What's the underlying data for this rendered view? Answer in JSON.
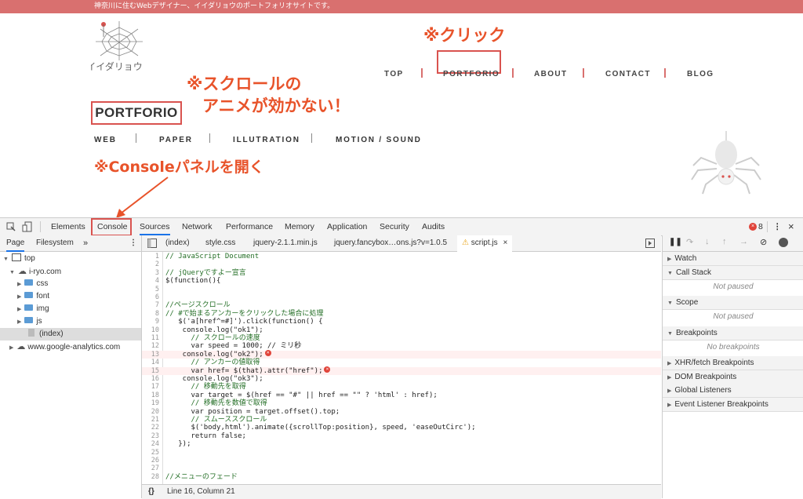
{
  "site": {
    "tagline": "神奈川に住むWebデザイナー、イイダリョウのポートフォリオサイトです。",
    "logo_text": "イイダリョウ",
    "nav": [
      "TOP",
      "PORTFORIO",
      "ABOUT",
      "CONTACT",
      "BLOG"
    ],
    "page_title": "PORTFORIO",
    "subnav": [
      "WEB",
      "PAPER",
      "ILLUTRATION",
      "MOTION / SOUND"
    ]
  },
  "annotations": {
    "click": "※クリック",
    "scroll_line1": "※スクロールの",
    "scroll_line2": "アニメが効かない！",
    "console": "※Consoleパネルを開く"
  },
  "devtools": {
    "tabs": [
      "Elements",
      "Console",
      "Sources",
      "Network",
      "Performance",
      "Memory",
      "Application",
      "Security",
      "Audits"
    ],
    "error_count": "8",
    "navigator_tabs": [
      "Page",
      "Filesystem"
    ],
    "tree": {
      "top": "top",
      "domain": "i-ryo.com",
      "folders": [
        "css",
        "font",
        "img",
        "js"
      ],
      "index": "(index)",
      "external": "www.google-analytics.com"
    },
    "editor_tabs": [
      "(index)",
      "style.css",
      "jquery-2.1.1.min.js",
      "jquery.fancybox…ons.js?v=1.0.5",
      "script.js"
    ],
    "code": [
      {
        "n": "1",
        "t": "// JavaScript Document"
      },
      {
        "n": "2",
        "t": ""
      },
      {
        "n": "3",
        "t": "// jQueryですよー宣言"
      },
      {
        "n": "4",
        "t": "$(function(){"
      },
      {
        "n": "5",
        "t": ""
      },
      {
        "n": "6",
        "t": ""
      },
      {
        "n": "7",
        "t": "//ページスクロール"
      },
      {
        "n": "8",
        "t": "// #で始まるアンカーをクリックした場合に処理"
      },
      {
        "n": "9",
        "t": "   $('a[href^=#]').click(function() {"
      },
      {
        "n": "10",
        "t": "    console.log(\"ok1\");"
      },
      {
        "n": "11",
        "t": "      // スクロールの速度"
      },
      {
        "n": "12",
        "t": "      var speed = 1000; // ミリ秒"
      },
      {
        "n": "13",
        "t": "    console.log(\"ok2\");"
      },
      {
        "n": "14",
        "t": "      // アンカーの値取得"
      },
      {
        "n": "15",
        "t": "      var href= $(that).attr(\"href\");"
      },
      {
        "n": "16",
        "t": "    console.log(\"ok3\");"
      },
      {
        "n": "17",
        "t": "      // 移動先を取得"
      },
      {
        "n": "18",
        "t": "      var target = $(href == \"#\" || href == \"\" ? 'html' : href);"
      },
      {
        "n": "19",
        "t": "      // 移動先を数値で取得"
      },
      {
        "n": "20",
        "t": "      var position = target.offset().top;"
      },
      {
        "n": "21",
        "t": "      // スムーススクロール"
      },
      {
        "n": "22",
        "t": "      $('body,html').animate({scrollTop:position}, speed, 'easeOutCirc');"
      },
      {
        "n": "23",
        "t": "      return false;"
      },
      {
        "n": "24",
        "t": "   });"
      },
      {
        "n": "25",
        "t": ""
      },
      {
        "n": "26",
        "t": ""
      },
      {
        "n": "27",
        "t": ""
      },
      {
        "n": "28",
        "t": "//メニューのフェード"
      }
    ],
    "status": "Line 16, Column 21",
    "status_icon": "{}",
    "debugger": {
      "watch": "Watch",
      "call_stack": "Call Stack",
      "not_paused": "Not paused",
      "scope": "Scope",
      "scope_note": "Not paused",
      "breakpoints": "Breakpoints",
      "no_breakpoints": "No breakpoints",
      "xhr": "XHR/fetch Breakpoints",
      "dom": "DOM Breakpoints",
      "global": "Global Listeners",
      "event": "Event Listener Breakpoints"
    }
  },
  "colors": {
    "accent": "#d9534f",
    "annotation": "#e8532a",
    "topbar": "#d9706f"
  }
}
